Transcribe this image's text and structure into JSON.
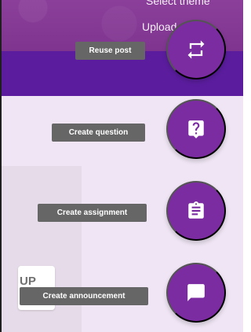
{
  "banner": {
    "select_theme_label": "Select theme",
    "upload_photo_label": "Upload photo"
  },
  "stream_card": {
    "partial_label": "UP"
  },
  "fab_menu": {
    "items": [
      {
        "label": "Reuse post",
        "icon": "repeat-icon"
      },
      {
        "label": "Create question",
        "icon": "question-icon"
      },
      {
        "label": "Create assignment",
        "icon": "clipboard-icon"
      },
      {
        "label": "Create announcement",
        "icon": "chat-icon"
      }
    ]
  },
  "colors": {
    "fab_purple": "#7b2ca1",
    "header_purple": "#5b1d9e",
    "banner_purple": "#8b3f9a",
    "background_lilac": "#efe5f4",
    "tooltip_gray": "#666666"
  }
}
